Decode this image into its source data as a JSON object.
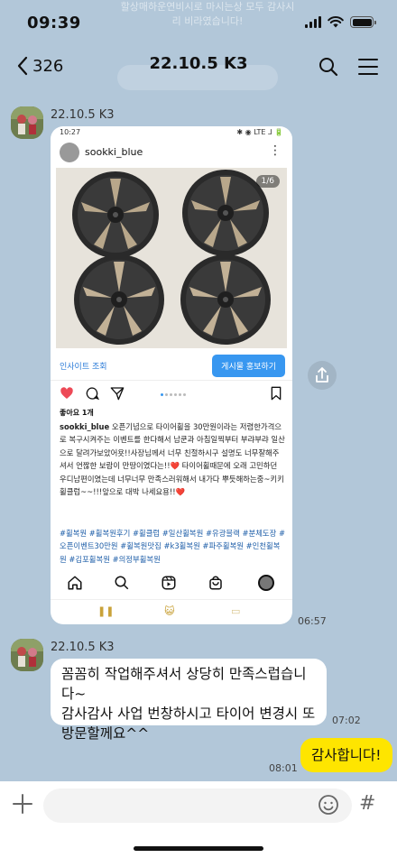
{
  "status_bar": {
    "time": "09:39"
  },
  "pinned_notice": {
    "text": "할상매하운연비시로 마시는상 모두 감사시리 비라였습니다!"
  },
  "header": {
    "back_count": "326",
    "title": "22.10.5 K3"
  },
  "messages": [
    {
      "sender": "22.10.5 K3",
      "type": "image",
      "time": "06:57",
      "instagram": {
        "status_time": "10:27",
        "status_right": "✱ ◉ LTE ⅃ 🔋",
        "username": "sookki_blue",
        "photo_counter": "1/6",
        "insights_label": "인사이트 조회",
        "promote_label": "게시물 홍보하기",
        "likes": "좋아요 1개",
        "caption_user": "sookki_blue",
        "caption": " 오픈기념으로 타이어휠을 30만원이라는 저렴한가격으로 복구시켜주는 이벤트를 한다해서 남쿤과 아침일찍부터 부랴부랴 일산으로 달려가보았어욧!!사장님께서 너무 친절하시구 설명도 너무잘해주셔서 언짢한 보람이 만땅이였다는!!❤️ 타이어휠때문에 오래 고민하던 우디남편이였는데 너무너무 만족스러워해서 내가다 뿌듯해하는중~키키 휠클럽~~!!!앞으로 대박 나세요용!!❤️",
        "hashtags": "#휠복원 #휠복원후기 #휠클럽 #일산휠복원 #유광블랙 #분체도장 #오픈이벤트30만원 #휠복원맛집 #k3휠복원 #파주휠복원 #인천휠복원 #김포휠복원 #의정부휠복원"
      }
    },
    {
      "sender": "22.10.5 K3",
      "type": "text",
      "text": "꼼꼼히 작업해주셔서 상당히 만족스럽습니다~\n감사감사 사업 번창하시고 타이어 변경시 또 방문할께요^^",
      "time": "07:02"
    },
    {
      "sender": "me",
      "type": "text",
      "text": "감사합니다!",
      "time": "08:01"
    }
  ],
  "input_bar": {
    "placeholder": ""
  },
  "colors": {
    "background": "#b2c7d9",
    "my_bubble": "#fee500",
    "their_bubble": "#ffffff"
  }
}
